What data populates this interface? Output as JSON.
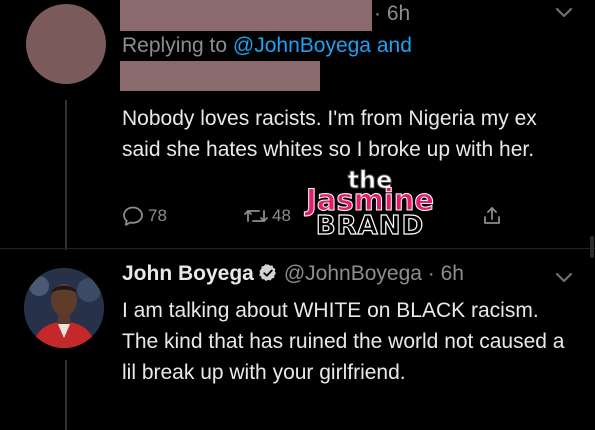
{
  "reply_tweet": {
    "time_suffix": "· 6h",
    "replying_prefix": "Replying to",
    "replying_handle": "@JohnBoyega",
    "replying_suffix": "and",
    "text": "Nobody loves racists. I'm from Nigeria my ex said she hates whites so I broke up with her.",
    "actions": {
      "reply_count": "78",
      "retweet_count": "48"
    }
  },
  "watermark": {
    "line1": "the",
    "line2": "Jasmine",
    "line3": "BRAND"
  },
  "main_tweet": {
    "display_name": "John Boyega",
    "handle": "@JohnBoyega",
    "time": "· 6h",
    "text": "I am talking about WHITE on BLACK racism. The kind that has ruined the world not caused a lil break up with your girlfriend."
  },
  "colors": {
    "background": "#000000",
    "accent": "#1da1f2",
    "watermark_pink": "#e31d6b",
    "redaction": "#8a6a6c"
  }
}
